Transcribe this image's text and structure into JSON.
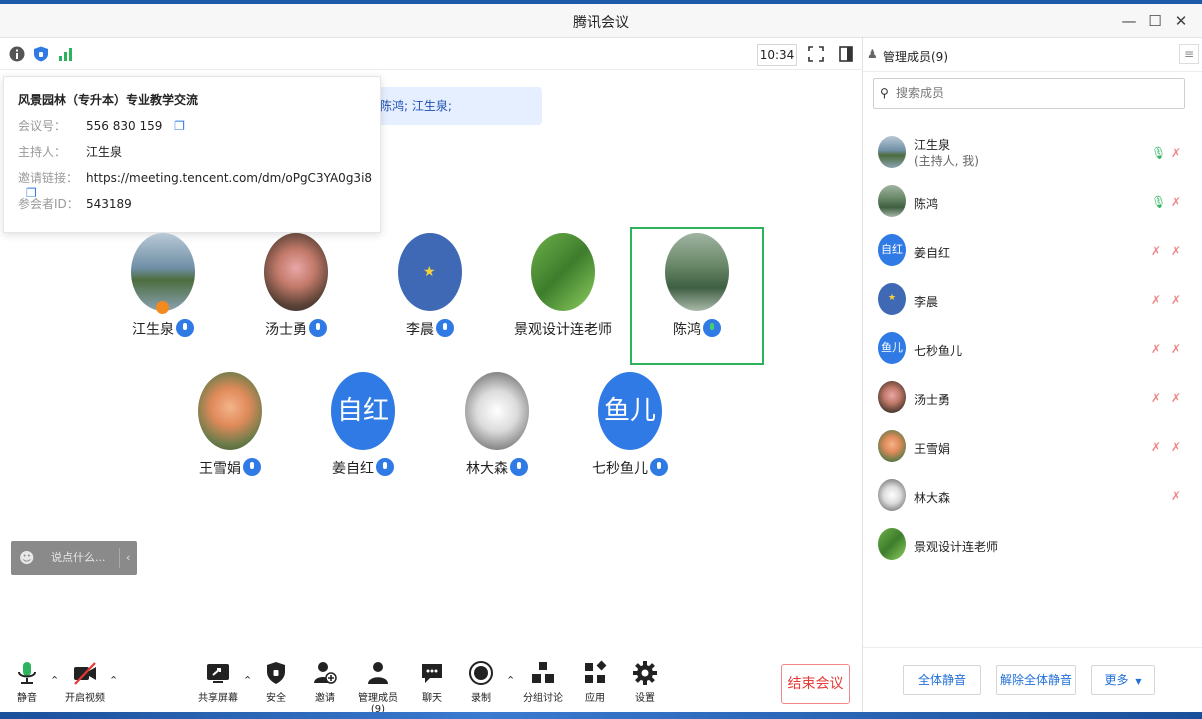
{
  "window": {
    "title": "腾讯会议"
  },
  "topbar": {
    "time": "10:34"
  },
  "info": {
    "topic": "风景园林（专升本）专业教学交流",
    "rows": [
      {
        "label": "会议号：",
        "value": "556 830 159"
      },
      {
        "label": "主持人：",
        "value": "江生泉"
      },
      {
        "label": "邀请链接：",
        "value": "https://meeting.tencent.com/dm/oPgC3YA0g3i8"
      },
      {
        "label": "参会者ID：",
        "value": "543189"
      }
    ]
  },
  "notification": "陈鸿; 江生泉;",
  "grid": [
    {
      "name": "江生泉",
      "avatar_text": ""
    },
    {
      "name": "汤士勇",
      "avatar_text": ""
    },
    {
      "name": "李晨",
      "avatar_text": ""
    },
    {
      "name": "景观设计连老师",
      "avatar_text": ""
    },
    {
      "name": "陈鸿",
      "avatar_text": ""
    },
    {
      "name": "王雪娟",
      "avatar_text": ""
    },
    {
      "name": "姜自红",
      "avatar_text": "自红"
    },
    {
      "name": "林大森",
      "avatar_text": ""
    },
    {
      "name": "七秒鱼儿",
      "avatar_text": "鱼儿"
    }
  ],
  "chat": {
    "placeholder": "说点什么..."
  },
  "toolbar": {
    "mute": "静音",
    "video": "开启视频",
    "share": "共享屏幕",
    "security": "安全",
    "invite": "邀请",
    "members": "管理成员(9)",
    "chat": "聊天",
    "record": "录制",
    "breakout": "分组讨论",
    "apps": "应用",
    "settings": "设置",
    "end": "结束会议"
  },
  "side": {
    "title": "管理成员(9)",
    "search_placeholder": "搜索成员",
    "members": [
      {
        "name": "江生泉",
        "sub": "(主持人, 我)",
        "avatar_text": ""
      },
      {
        "name": "陈鸿",
        "sub": "",
        "avatar_text": ""
      },
      {
        "name": "姜自红",
        "sub": "",
        "avatar_text": "自红"
      },
      {
        "name": "李晨",
        "sub": "",
        "avatar_text": ""
      },
      {
        "name": "七秒鱼儿",
        "sub": "",
        "avatar_text": "鱼儿"
      },
      {
        "name": "汤士勇",
        "sub": "",
        "avatar_text": ""
      },
      {
        "name": "王雪娟",
        "sub": "",
        "avatar_text": ""
      },
      {
        "name": "林大森",
        "sub": "",
        "avatar_text": ""
      },
      {
        "name": "景观设计连老师",
        "sub": "",
        "avatar_text": ""
      }
    ],
    "mute_all": "全体静音",
    "unmute_all": "解除全体静音",
    "more": "更多"
  },
  "colors": {
    "accent": "#2f7ae5",
    "danger": "#e53935",
    "speaking": "#2db35c"
  }
}
